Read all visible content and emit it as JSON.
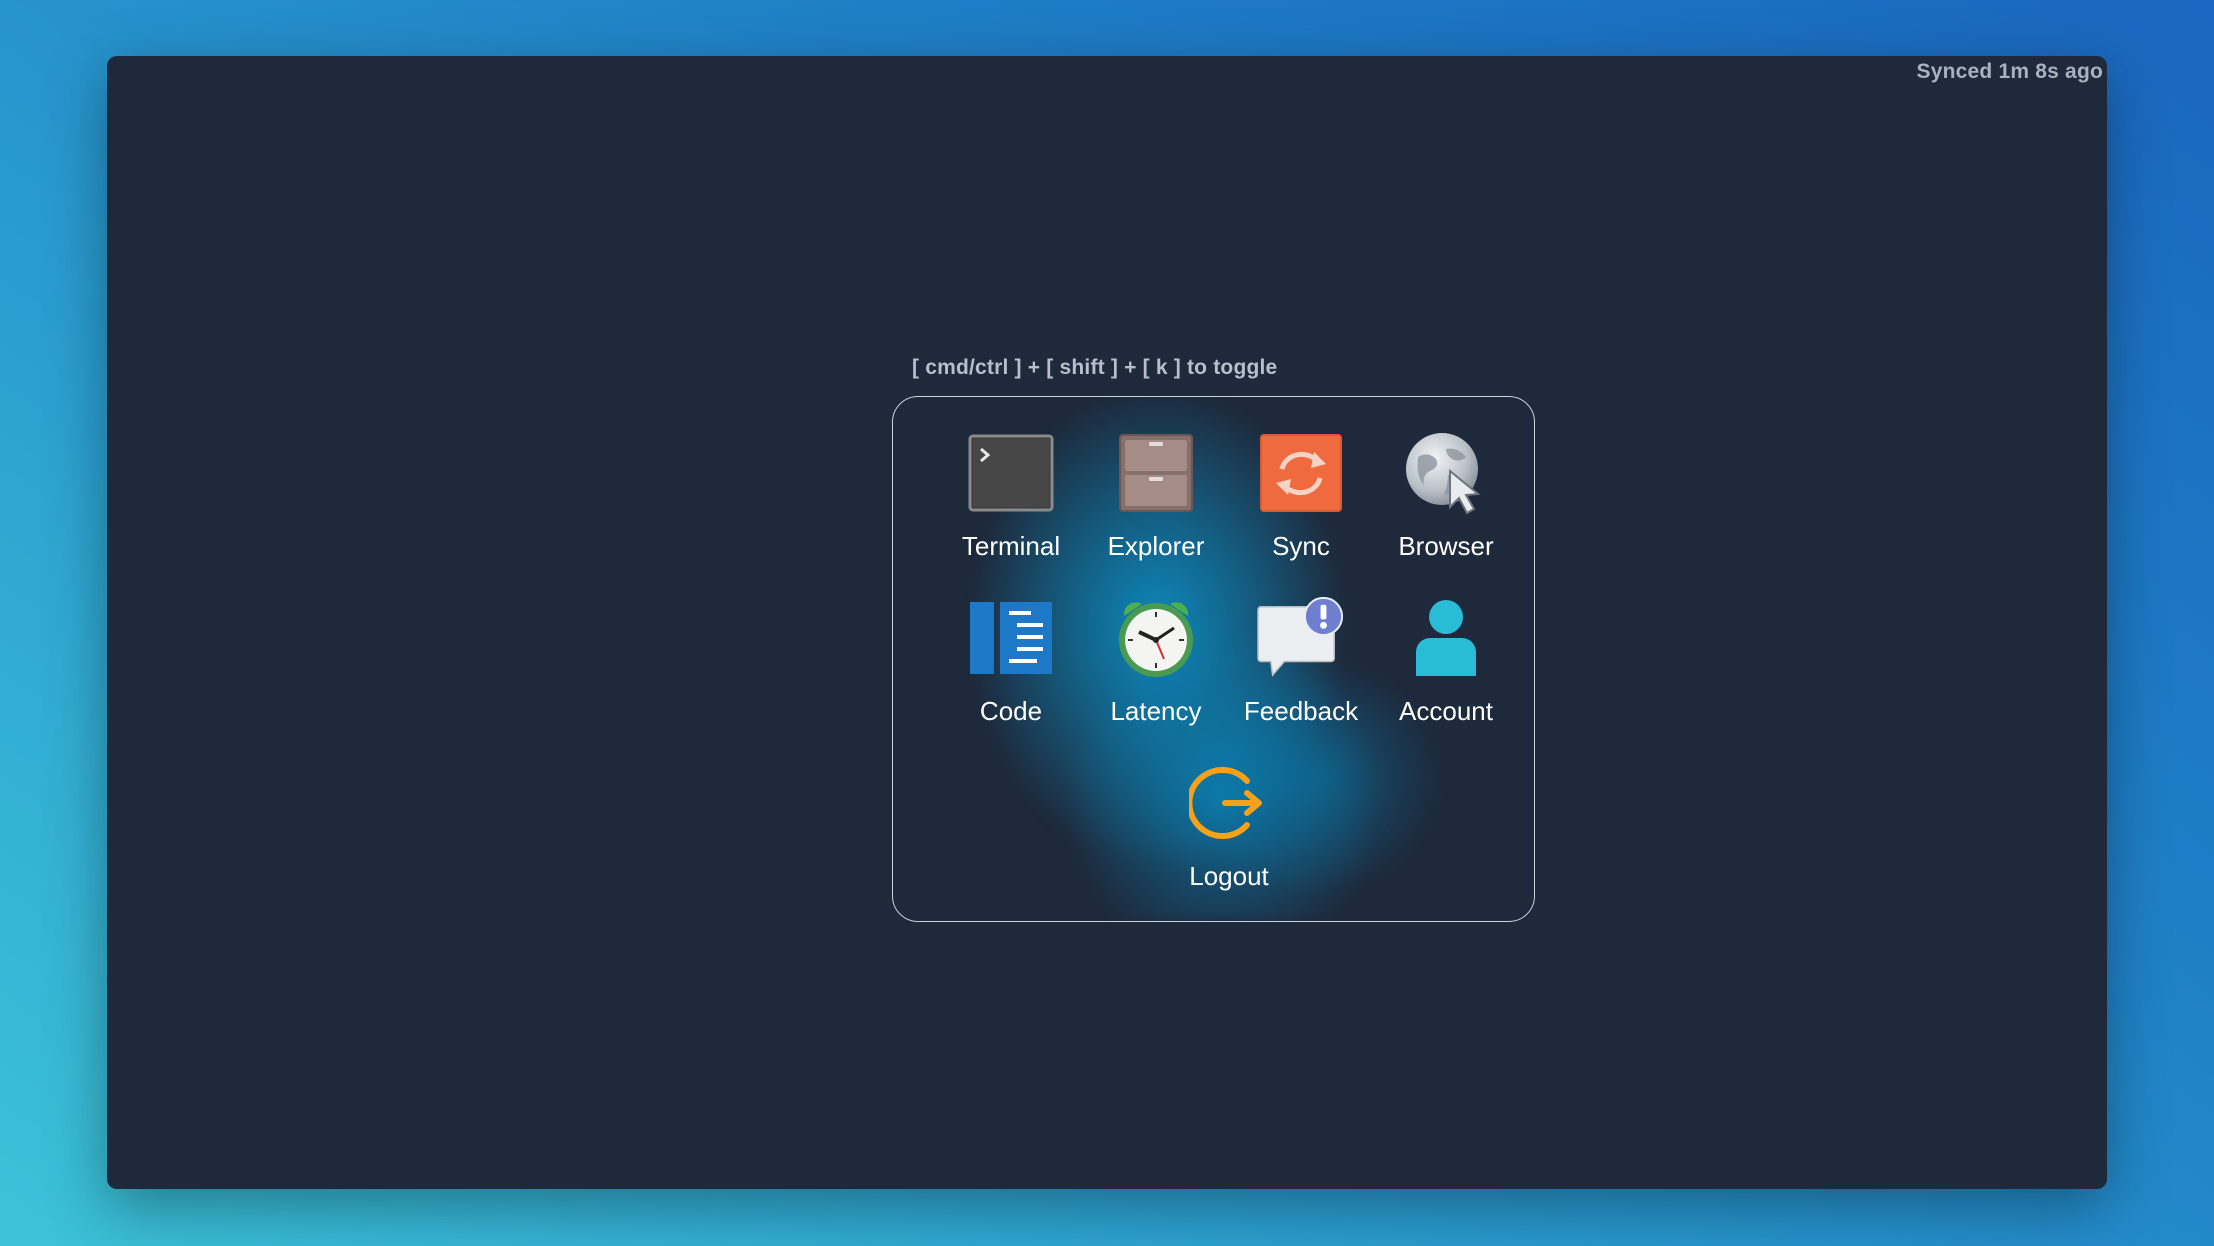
{
  "status": {
    "synced": "Synced 1m 8s ago"
  },
  "launcher": {
    "hint": "[ cmd/ctrl ] + [ shift ] + [ k ] to toggle",
    "apps": [
      {
        "id": "terminal",
        "label": "Terminal",
        "icon": "terminal-icon"
      },
      {
        "id": "explorer",
        "label": "Explorer",
        "icon": "file-cabinet-icon"
      },
      {
        "id": "sync",
        "label": "Sync",
        "icon": "sync-icon"
      },
      {
        "id": "browser",
        "label": "Browser",
        "icon": "globe-cursor-icon"
      },
      {
        "id": "code",
        "label": "Code",
        "icon": "code-editor-icon"
      },
      {
        "id": "latency",
        "label": "Latency",
        "icon": "alarm-clock-icon"
      },
      {
        "id": "feedback",
        "label": "Feedback",
        "icon": "feedback-bubble-icon"
      },
      {
        "id": "account",
        "label": "Account",
        "icon": "user-icon"
      },
      {
        "id": "logout",
        "label": "Logout",
        "icon": "logout-icon"
      }
    ]
  },
  "colors": {
    "window_bg": "#1e293b",
    "sync_orange": "#f06a3f",
    "logout_orange": "#f5a21b",
    "code_blue": "#1d78c8",
    "account_cyan": "#29bcd6",
    "feedback_badge": "#6e7fd0"
  }
}
